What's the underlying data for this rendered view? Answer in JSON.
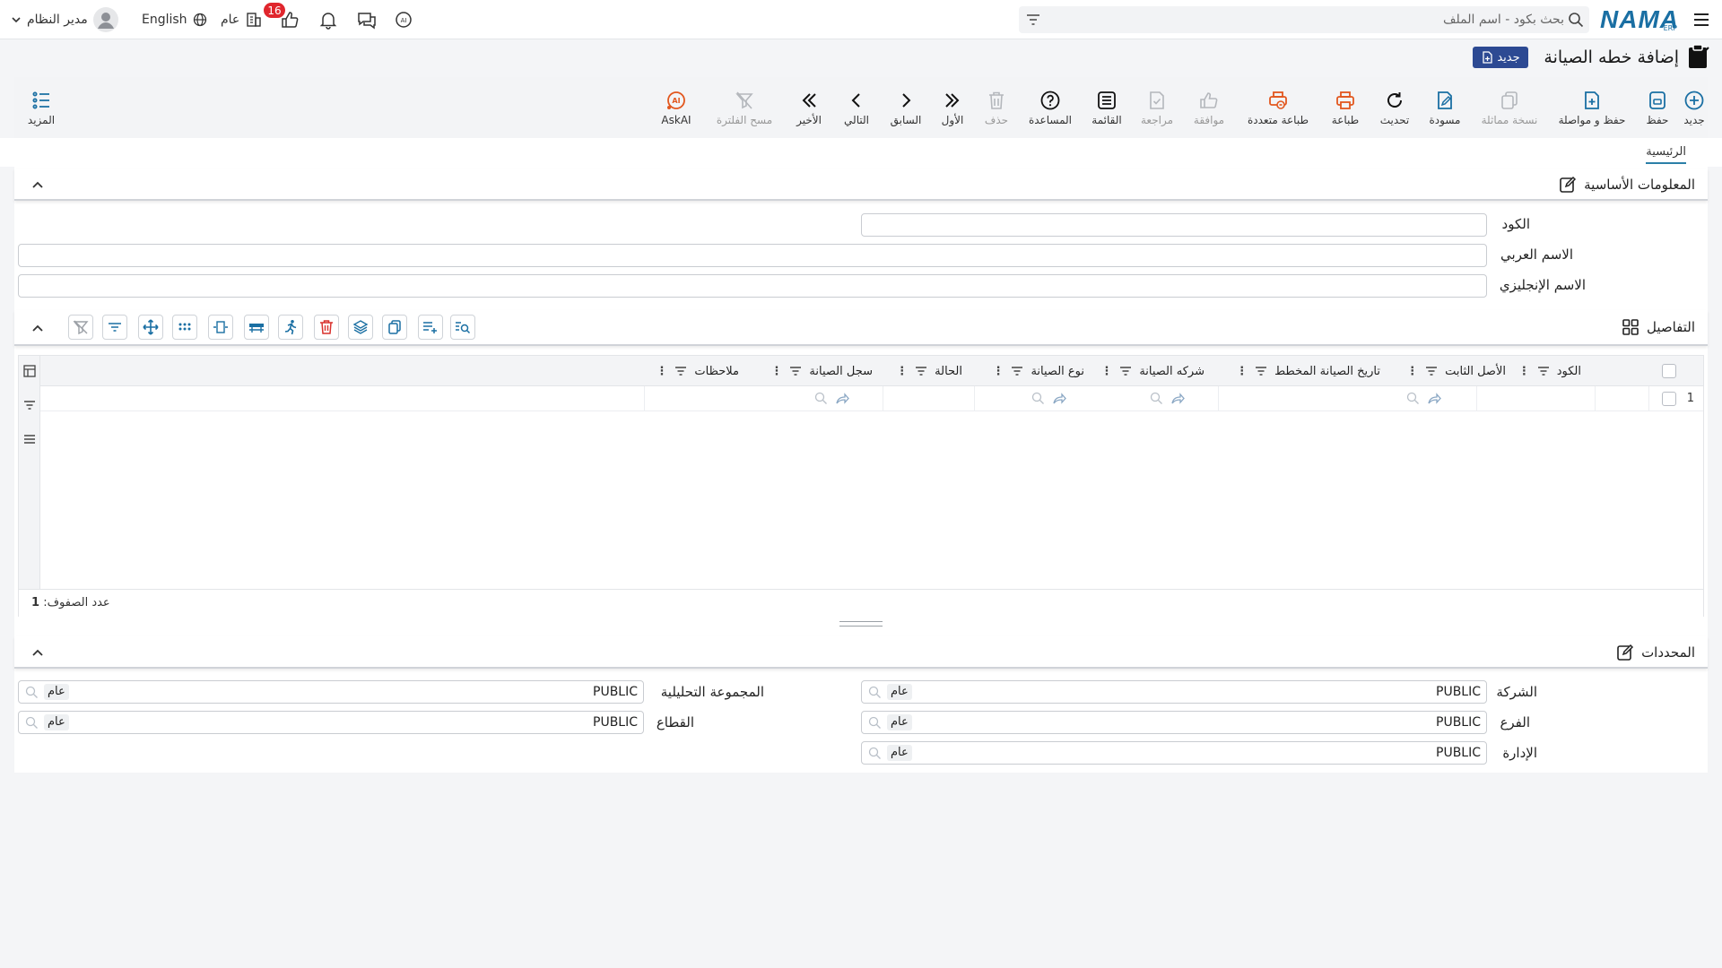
{
  "topbar": {
    "logo_text": "NAMA",
    "logo_sub": "ERP",
    "search_placeholder": "بحث بكود - اسم الملف",
    "user_name": "مدير النظام",
    "language": "English",
    "scope": "عام",
    "notification_count": "16"
  },
  "page": {
    "title": "إضافة خطه الصيانة",
    "new_badge": "جديد"
  },
  "toolbar": {
    "more": "المزيد",
    "items": [
      {
        "label": "جديد",
        "icon": "plus-circle-icon"
      },
      {
        "label": "حفظ",
        "icon": "save-icon"
      },
      {
        "label": "حفظ و مواصلة",
        "icon": "save-continue-icon"
      },
      {
        "label": "نسخة مماثلة",
        "icon": "copy-icon"
      },
      {
        "label": "مسودة",
        "icon": "draft-icon"
      },
      {
        "label": "تحديث",
        "icon": "refresh-icon"
      },
      {
        "label": "طباعة",
        "icon": "print-icon"
      },
      {
        "label": "طباعة متعددة",
        "icon": "multi-print-icon"
      },
      {
        "label": "موافقة",
        "icon": "approve-icon"
      },
      {
        "label": "مراجعة",
        "icon": "review-icon"
      },
      {
        "label": "القائمة",
        "icon": "list-icon"
      },
      {
        "label": "المساعدة",
        "icon": "help-icon"
      },
      {
        "label": "حذف",
        "icon": "trash-icon"
      },
      {
        "label": "الأول",
        "icon": "first-icon"
      },
      {
        "label": "السابق",
        "icon": "previous-icon"
      },
      {
        "label": "التالي",
        "icon": "next-icon"
      },
      {
        "label": "الأخير",
        "icon": "last-icon"
      },
      {
        "label": "مسح الفلترة",
        "icon": "clear-filter-icon"
      },
      {
        "label": "AskAI",
        "icon": "ai-icon"
      }
    ]
  },
  "tabs": {
    "main": "الرئيسية"
  },
  "basic_info": {
    "title": "المعلومات الأساسية",
    "code_label": "الكود",
    "arabic_name_label": "الاسم العربي",
    "english_name_label": "الاسم الإنجليزي"
  },
  "details": {
    "title": "التفاصيل",
    "columns": [
      "الكود",
      "الأصل الثابت",
      "تاريخ الصيانة المخطط",
      "شركه الصيانة",
      "نوع الصيانة",
      "الحالة",
      "سجل الصيانة",
      "ملاحظات"
    ],
    "row_number": "1",
    "row_count_label": "عدد الصفوف:",
    "row_count": "1"
  },
  "dimensions": {
    "title": "المحددات",
    "company_label": "الشركة",
    "branch_label": "الفرع",
    "department_label": "الإدارة",
    "analytic_group_label": "المجموعة التحليلية",
    "sector_label": "القطاع",
    "value": "PUBLIC",
    "chip": "عام"
  },
  "colors": {
    "accent": "#1a6fa3",
    "orange": "#e2571e",
    "badge_red": "#e0262d",
    "title_badge": "#2d4a93"
  }
}
